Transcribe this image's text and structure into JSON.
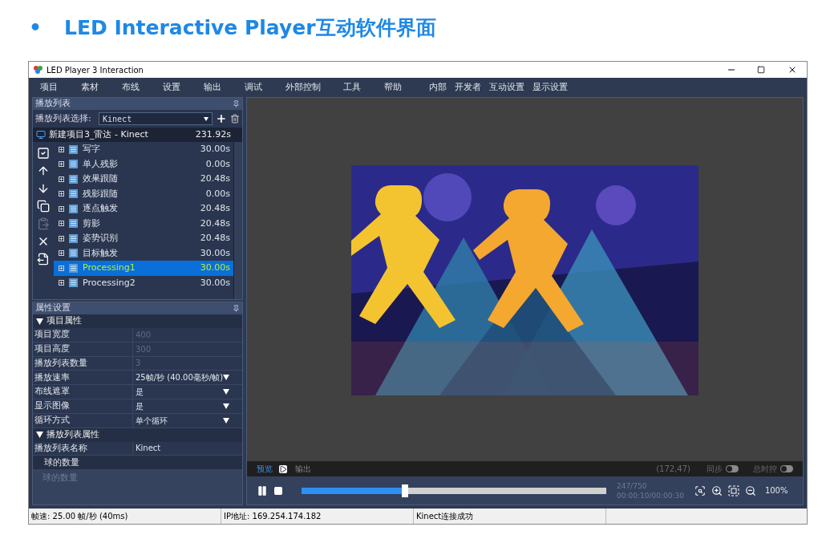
{
  "slide_title": {
    "bullet": "•",
    "text": "LED Interactive Player互动软件界面"
  },
  "window": {
    "title": "LED Player 3 Interaction"
  },
  "menu": [
    "项目",
    "素材",
    "布线",
    "设置",
    "输出",
    "调试",
    "外部控制",
    "工具",
    "帮助",
    "内部",
    "开发者",
    "互动设置",
    "显示设置"
  ],
  "playlist_panel": {
    "title": "播放列表",
    "select_label": "播放列表选择:",
    "select_value": "Kinect",
    "project": {
      "name": "新建项目3_雷达 - Kinect",
      "duration": "231.92s"
    },
    "tools": [
      {
        "kind": "check",
        "disabled": false
      },
      {
        "kind": "up",
        "disabled": false
      },
      {
        "kind": "down",
        "disabled": false
      },
      {
        "kind": "copy",
        "disabled": false
      },
      {
        "kind": "paste",
        "disabled": true
      },
      {
        "kind": "delete",
        "disabled": false
      },
      {
        "kind": "export",
        "disabled": false
      }
    ],
    "items": [
      {
        "name": "写字",
        "duration": "30.00s",
        "selected": false
      },
      {
        "name": "单人残影",
        "duration": "0.00s",
        "selected": false
      },
      {
        "name": "效果跟随",
        "duration": "20.48s",
        "selected": false
      },
      {
        "name": "残影跟随",
        "duration": "0.00s",
        "selected": false
      },
      {
        "name": "逐点触发",
        "duration": "20.48s",
        "selected": false
      },
      {
        "name": "剪影",
        "duration": "20.48s",
        "selected": false
      },
      {
        "name": "姿势识别",
        "duration": "20.48s",
        "selected": false
      },
      {
        "name": "目标触发",
        "duration": "30.00s",
        "selected": false
      },
      {
        "name": "Processing1",
        "duration": "30.00s",
        "selected": true
      },
      {
        "name": "Processing2",
        "duration": "30.00s",
        "selected": false
      }
    ]
  },
  "property_panel": {
    "title": "属性设置",
    "sections": [
      {
        "title": "项目属性",
        "expanded": true,
        "rows": [
          {
            "label": "项目宽度",
            "value": "400",
            "kind": "text",
            "disabled": true
          },
          {
            "label": "项目高度",
            "value": "300",
            "kind": "text",
            "disabled": true
          },
          {
            "label": "播放列表数量",
            "value": "3",
            "kind": "text",
            "disabled": true
          },
          {
            "label": "播放速率",
            "value": "25帧/秒 (40.00毫秒/帧)",
            "kind": "dropdown",
            "disabled": false
          },
          {
            "label": "布线遮罩",
            "value": "是",
            "kind": "dropdown",
            "disabled": false
          },
          {
            "label": "显示图像",
            "value": "是",
            "kind": "dropdown",
            "disabled": false
          },
          {
            "label": "循环方式",
            "value": "单个循环",
            "kind": "dropdown",
            "disabled": false
          }
        ]
      },
      {
        "title": "播放列表属性",
        "expanded": true,
        "rows": [
          {
            "label": "播放列表名称",
            "value": "Kinect",
            "kind": "text",
            "disabled": false
          }
        ]
      }
    ],
    "description": {
      "title": "球的数量",
      "text": "球的数量"
    }
  },
  "preview": {
    "tabs": [
      {
        "label": "预览",
        "selected": true
      },
      {
        "label": "输出",
        "selected": false
      }
    ],
    "coords": "(172,47)",
    "toggles": [
      {
        "label": "同步",
        "on": false
      },
      {
        "label": "总时控",
        "on": false
      }
    ],
    "progress": {
      "level": 0.34,
      "frames": "247/750",
      "time": "00:00:10/00:00:30"
    },
    "zoom": "100%"
  },
  "status_bar": [
    "帧速: 25.00 帧/秒 (40ms)",
    "IP地址: 169.254.174.182",
    "Kinect连接成功"
  ]
}
